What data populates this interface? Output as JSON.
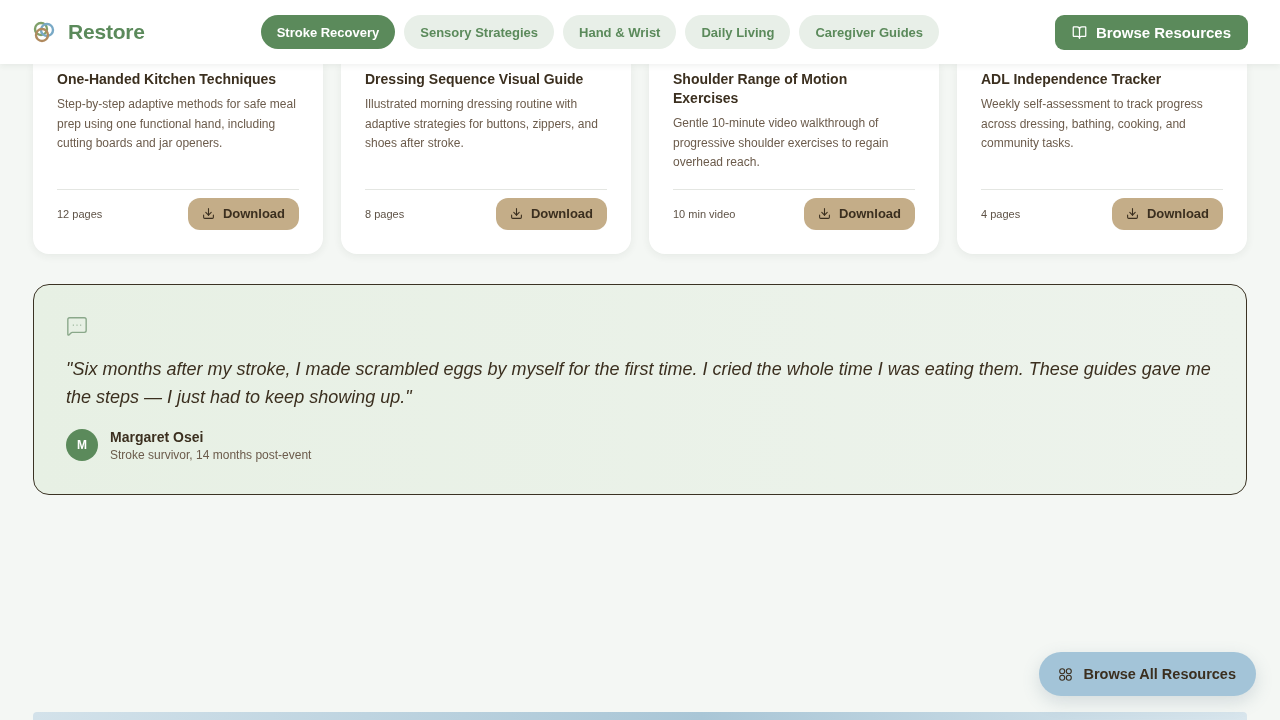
{
  "header": {
    "logo": {
      "name": "Restore"
    },
    "nav": [
      {
        "label": "Stroke Recovery",
        "selected": true
      },
      {
        "label": "Sensory Strategies",
        "selected": false
      },
      {
        "label": "Hand & Wrist",
        "selected": false
      },
      {
        "label": "Daily Living",
        "selected": false
      },
      {
        "label": "Caregiver Guides",
        "selected": false
      }
    ],
    "cta": {
      "label": "Browse Resources"
    }
  },
  "resources": [
    {
      "title": "One-Handed Kitchen Techniques",
      "description": "Step-by-step adaptive methods for safe meal prep using one functional hand, including cutting boards and jar openers.",
      "meta": "12 pages",
      "action": "Download"
    },
    {
      "title": "Dressing Sequence Visual Guide",
      "description": "Illustrated morning dressing routine with adaptive strategies for buttons, zippers, and shoes after stroke.",
      "meta": "8 pages",
      "action": "Download"
    },
    {
      "title": "Shoulder Range of Motion Exercises",
      "description": "Gentle 10-minute video walkthrough of progressive shoulder exercises to regain overhead reach.",
      "meta": "10 min video",
      "action": "Download"
    },
    {
      "title": "ADL Independence Tracker",
      "description": "Weekly self-assessment to track progress across dressing, bathing, cooking, and community tasks.",
      "meta": "4 pages",
      "action": "Download"
    }
  ],
  "testimonial": {
    "quote": "\"Six months after my stroke, I made scrambled eggs by myself for the first time. I cried the whole time I was eating them. These guides gave me the steps — I just had to keep showing up.\"",
    "author": {
      "initial": "M",
      "name": "Margaret Osei",
      "role": "Stroke survivor, 14 months post-event"
    }
  },
  "floating_button": {
    "label": "Browse All Resources"
  }
}
